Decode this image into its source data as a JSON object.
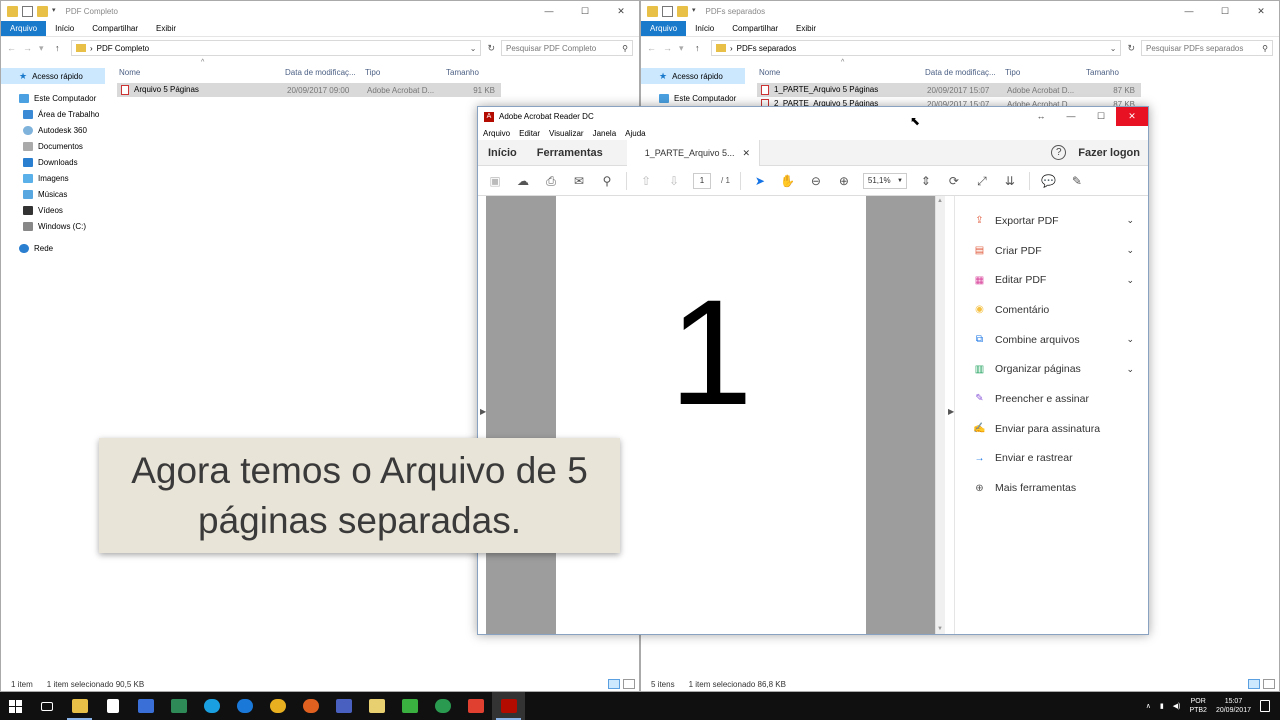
{
  "left_explorer": {
    "title": "PDF Completo",
    "ribbon": [
      "Arquivo",
      "Início",
      "Compartilhar",
      "Exibir"
    ],
    "address": "PDF Completo",
    "search_placeholder": "Pesquisar PDF Completo",
    "columns": [
      "Nome",
      "Data de modificaç...",
      "Tipo",
      "Tamanho"
    ],
    "files": [
      {
        "name": "Arquivo 5 Páginas",
        "date": "20/09/2017 09:00",
        "type": "Adobe Acrobat D...",
        "size": "91 KB"
      }
    ],
    "nav": {
      "quick": "Acesso rápido",
      "pc": "Este Computador",
      "items": [
        "Área de Trabalho",
        "Autodesk 360",
        "Documentos",
        "Downloads",
        "Imagens",
        "Músicas",
        "Vídeos",
        "Windows (C:)"
      ],
      "network": "Rede"
    },
    "status": {
      "count": "1 item",
      "selected": "1 item selecionado  90,5 KB"
    }
  },
  "right_explorer": {
    "title": "PDFs separados",
    "ribbon": [
      "Arquivo",
      "Início",
      "Compartilhar",
      "Exibir"
    ],
    "address": "PDFs separados",
    "search_placeholder": "Pesquisar PDFs separados",
    "columns": [
      "Nome",
      "Data de modificaç...",
      "Tipo",
      "Tamanho"
    ],
    "files": [
      {
        "name": "1_PARTE_Arquivo 5 Páginas",
        "date": "20/09/2017 15:07",
        "type": "Adobe Acrobat D...",
        "size": "87 KB"
      },
      {
        "name": "2_PARTE_Arquivo 5 Páginas",
        "date": "20/09/2017 15:07",
        "type": "Adobe Acrobat D...",
        "size": "87 KB"
      }
    ],
    "nav": {
      "quick": "Acesso rápido",
      "pc": "Este Computador"
    },
    "status": {
      "count": "5 itens",
      "selected": "1 item selecionado  86,8 KB"
    }
  },
  "acrobat": {
    "title": "Adobe Acrobat Reader DC",
    "menu": [
      "Arquivo",
      "Editar",
      "Visualizar",
      "Janela",
      "Ajuda"
    ],
    "tabs": {
      "home": "Início",
      "tools": "Ferramentas",
      "doc": "1_PARTE_Arquivo 5..."
    },
    "login": "Fazer logon",
    "page_current": "1",
    "page_total": "/ 1",
    "zoom": "51,1%",
    "page_content": "1",
    "tools": [
      {
        "label": "Exportar PDF",
        "icon": "export-pdf-icon",
        "color": "#e05a3c",
        "expand": true
      },
      {
        "label": "Criar PDF",
        "icon": "create-pdf-icon",
        "color": "#e05a3c",
        "expand": true
      },
      {
        "label": "Editar PDF",
        "icon": "edit-pdf-icon",
        "color": "#d9439b",
        "expand": true
      },
      {
        "label": "Comentário",
        "icon": "comment-icon",
        "color": "#f5c040",
        "expand": false
      },
      {
        "label": "Combine arquivos",
        "icon": "combine-files-icon",
        "color": "#1473e6",
        "expand": true
      },
      {
        "label": "Organizar páginas",
        "icon": "organize-pages-icon",
        "color": "#1ca05a",
        "expand": true
      },
      {
        "label": "Preencher e assinar",
        "icon": "fill-sign-icon",
        "color": "#8a57d8",
        "expand": false
      },
      {
        "label": "Enviar para assinatura",
        "icon": "send-signature-icon",
        "color": "#7a53c8",
        "expand": false
      },
      {
        "label": "Enviar e rastrear",
        "icon": "send-track-icon",
        "color": "#1473e6",
        "expand": false
      },
      {
        "label": "Mais ferramentas",
        "icon": "more-tools-icon",
        "color": "#555555",
        "expand": false
      }
    ]
  },
  "caption": "Agora temos o Arquivo de 5 páginas separadas.",
  "taskbar": {
    "lang1": "POR",
    "lang2": "PTB2",
    "time": "15:07",
    "date": "20/09/2017"
  }
}
